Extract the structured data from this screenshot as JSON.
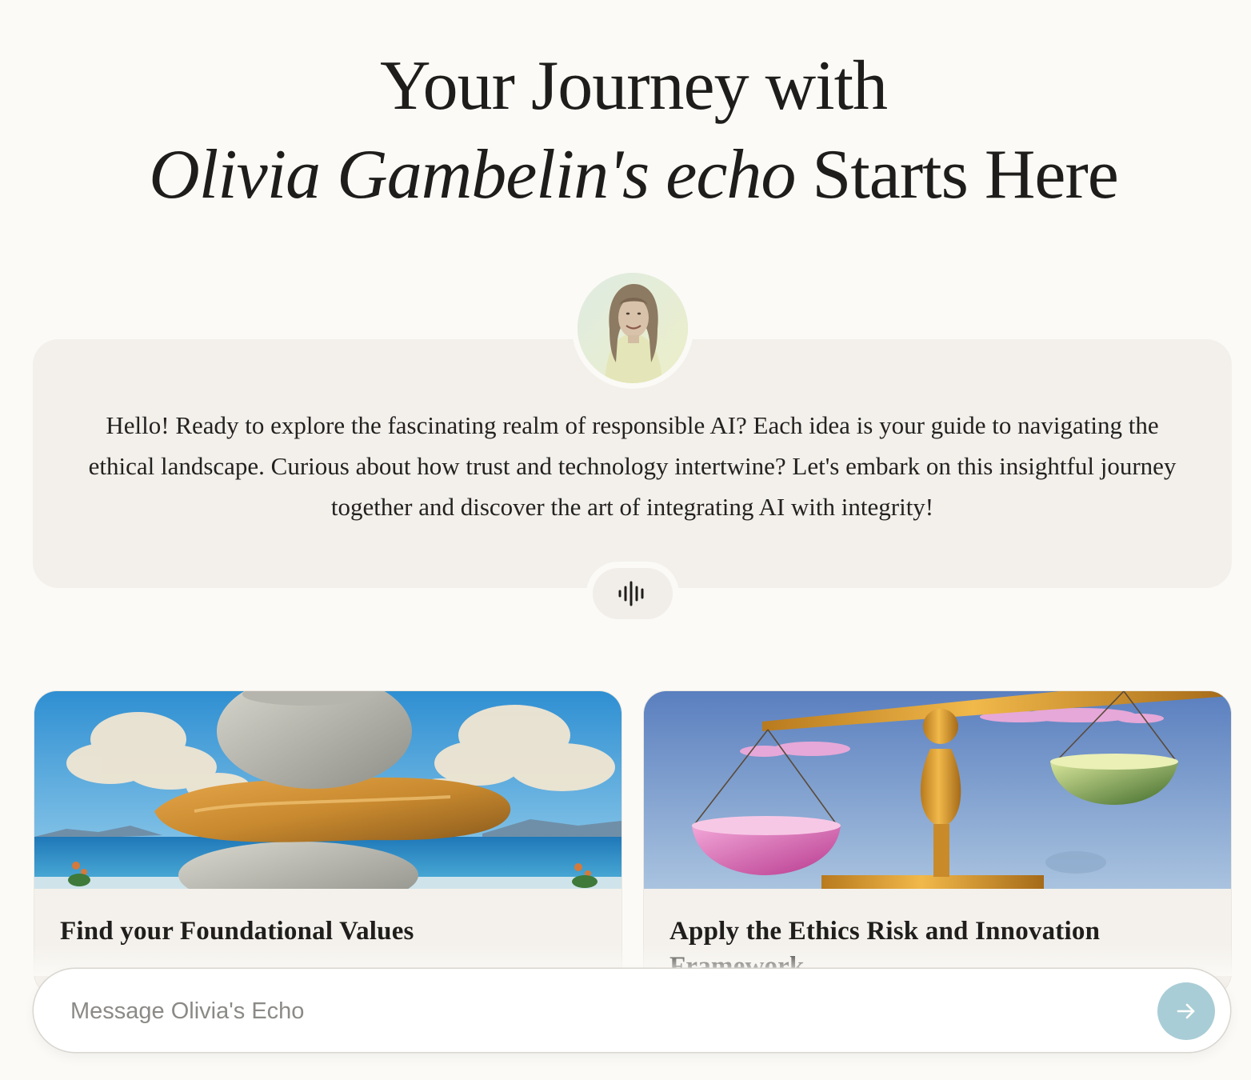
{
  "hero": {
    "line1": "Your Journey with",
    "line2_italic": "Olivia Gambelin's echo",
    "line2_rest": " Starts Here"
  },
  "intro": {
    "message": "Hello! Ready to explore the fascinating realm of responsible AI? Each idea is your guide to navigating the ethical landscape. Curious about how trust and technology intertwine? Let's embark on this insightful journey together and discover the art of integrating AI with integrity!"
  },
  "icons": {
    "audio": "audio-waveform-icon",
    "send": "arrow-right-icon"
  },
  "cards": [
    {
      "title": "Find your Foundational Values"
    },
    {
      "title": "Apply the Ethics Risk and Innovation Framework"
    }
  ],
  "composer": {
    "placeholder": "Message Olivia's Echo",
    "value": ""
  },
  "colors": {
    "page_background": "#fbfaf6",
    "card_background": "#f3f0eb",
    "send_button": "#a9cdd6"
  }
}
